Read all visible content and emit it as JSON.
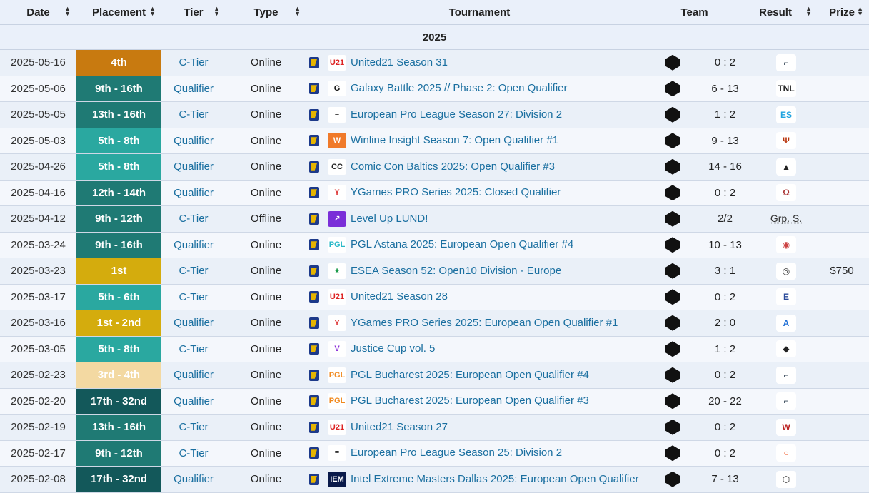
{
  "headers": {
    "date": "Date",
    "placement": "Placement",
    "tier": "Tier",
    "type": "Type",
    "tournament": "Tournament",
    "team": "Team",
    "result": "Result",
    "prize": "Prize"
  },
  "year": "2025",
  "rows": [
    {
      "date": "2025-05-16",
      "placement": "4th",
      "pclass": "p-orange",
      "tier": "C-Tier",
      "type": "Online",
      "logo": "u21-logo",
      "tournament": "United21 Season 31",
      "result": "0 : 2",
      "opp": "cs-icon",
      "prize": ""
    },
    {
      "date": "2025-05-06",
      "placement": "9th - 16th",
      "pclass": "p-teal1",
      "tier": "Qualifier",
      "type": "Online",
      "logo": "galaxy-logo",
      "tournament": "Galaxy Battle 2025 // Phase 2: Open Qualifier",
      "result": "6 - 13",
      "opp": "tnl-logo",
      "prize": ""
    },
    {
      "date": "2025-05-05",
      "placement": "13th - 16th",
      "pclass": "p-teal1",
      "tier": "C-Tier",
      "type": "Online",
      "logo": "epl-logo",
      "tournament": "European Pro League Season 27: Division 2",
      "result": "1 : 2",
      "opp": "esc-logo",
      "prize": ""
    },
    {
      "date": "2025-05-03",
      "placement": "5th - 8th",
      "pclass": "p-teal2",
      "tier": "Qualifier",
      "type": "Online",
      "logo": "winline-logo",
      "tournament": "Winline Insight Season 7: Open Qualifier #1",
      "result": "9 - 13",
      "opp": "sparta-logo",
      "prize": ""
    },
    {
      "date": "2025-04-26",
      "placement": "5th - 8th",
      "pclass": "p-teal2",
      "tier": "Qualifier",
      "type": "Online",
      "logo": "comiccon-logo",
      "tournament": "Comic Con Baltics 2025: Open Qualifier #3",
      "result": "14 - 16",
      "opp": "team-logo-2",
      "prize": ""
    },
    {
      "date": "2025-04-16",
      "placement": "12th - 14th",
      "pclass": "p-teal1",
      "tier": "Qualifier",
      "type": "Online",
      "logo": "ygames-logo",
      "tournament": "YGames PRO Series 2025: Closed Qualifier",
      "result": "0 : 2",
      "opp": "helmet-logo",
      "prize": ""
    },
    {
      "date": "2025-04-12",
      "placement": "9th - 12th",
      "pclass": "p-teal1",
      "tier": "C-Tier",
      "type": "Offline",
      "logo": "levelup-logo",
      "tournament": "Level Up LUND!",
      "result": "2/2",
      "opp": "",
      "oppText": "Grp. S.",
      "prize": ""
    },
    {
      "date": "2025-03-24",
      "placement": "9th - 16th",
      "pclass": "p-teal1",
      "tier": "Qualifier",
      "type": "Online",
      "logo": "pgl-logo",
      "tournament": "PGL Astana 2025: European Open Qualifier #4",
      "result": "10 - 13",
      "opp": "bear-logo",
      "prize": ""
    },
    {
      "date": "2025-03-23",
      "placement": "1st",
      "pclass": "p-gold",
      "tier": "C-Tier",
      "type": "Online",
      "logo": "esea-logo",
      "tournament": "ESEA Season 52: Open10 Division - Europe",
      "result": "3 : 1",
      "opp": "mask-logo",
      "prize": "$750"
    },
    {
      "date": "2025-03-17",
      "placement": "5th - 6th",
      "pclass": "p-teal2",
      "tier": "C-Tier",
      "type": "Online",
      "logo": "u21-logo",
      "tournament": "United21 Season 28",
      "result": "0 : 2",
      "opp": "eagle-logo",
      "prize": ""
    },
    {
      "date": "2025-03-16",
      "placement": "1st - 2nd",
      "pclass": "p-gold",
      "tier": "Qualifier",
      "type": "Online",
      "logo": "ygames-logo",
      "tournament": "YGames PRO Series 2025: European Open Qualifier #1",
      "result": "2 : 0",
      "opp": "blue-a-logo",
      "prize": ""
    },
    {
      "date": "2025-03-05",
      "placement": "5th - 8th",
      "pclass": "p-teal2",
      "tier": "C-Tier",
      "type": "Online",
      "logo": "justice-logo",
      "tournament": "Justice Cup vol. 5",
      "result": "1 : 2",
      "opp": "ninja-logo",
      "prize": ""
    },
    {
      "date": "2025-02-23",
      "placement": "3rd - 4th",
      "pclass": "p-beige",
      "tier": "Qualifier",
      "type": "Online",
      "logo": "pgl-logo-orange",
      "tournament": "PGL Bucharest 2025: European Open Qualifier #4",
      "result": "0 : 2",
      "opp": "cs-icon",
      "prize": ""
    },
    {
      "date": "2025-02-20",
      "placement": "17th - 32nd",
      "pclass": "p-teal3",
      "tier": "Qualifier",
      "type": "Online",
      "logo": "pgl-logo-orange",
      "tournament": "PGL Bucharest 2025: European Open Qualifier #3",
      "result": "20 - 22",
      "opp": "cs-icon",
      "prize": ""
    },
    {
      "date": "2025-02-19",
      "placement": "13th - 16th",
      "pclass": "p-teal1",
      "tier": "C-Tier",
      "type": "Online",
      "logo": "u21-logo",
      "tournament": "United21 Season 27",
      "result": "0 : 2",
      "opp": "wolf-logo",
      "prize": ""
    },
    {
      "date": "2025-02-17",
      "placement": "9th - 12th",
      "pclass": "p-teal1",
      "tier": "C-Tier",
      "type": "Online",
      "logo": "epl-logo",
      "tournament": "European Pro League Season 25: Division 2",
      "result": "0 : 2",
      "opp": "ring-logo",
      "prize": ""
    },
    {
      "date": "2025-02-08",
      "placement": "17th - 32nd",
      "pclass": "p-teal3",
      "tier": "Qualifier",
      "type": "Online",
      "logo": "iem-logo",
      "tournament": "Intel Extreme Masters Dallas 2025: European Open Qualifier",
      "result": "7 - 13",
      "opp": "hex-logo",
      "prize": ""
    }
  ]
}
